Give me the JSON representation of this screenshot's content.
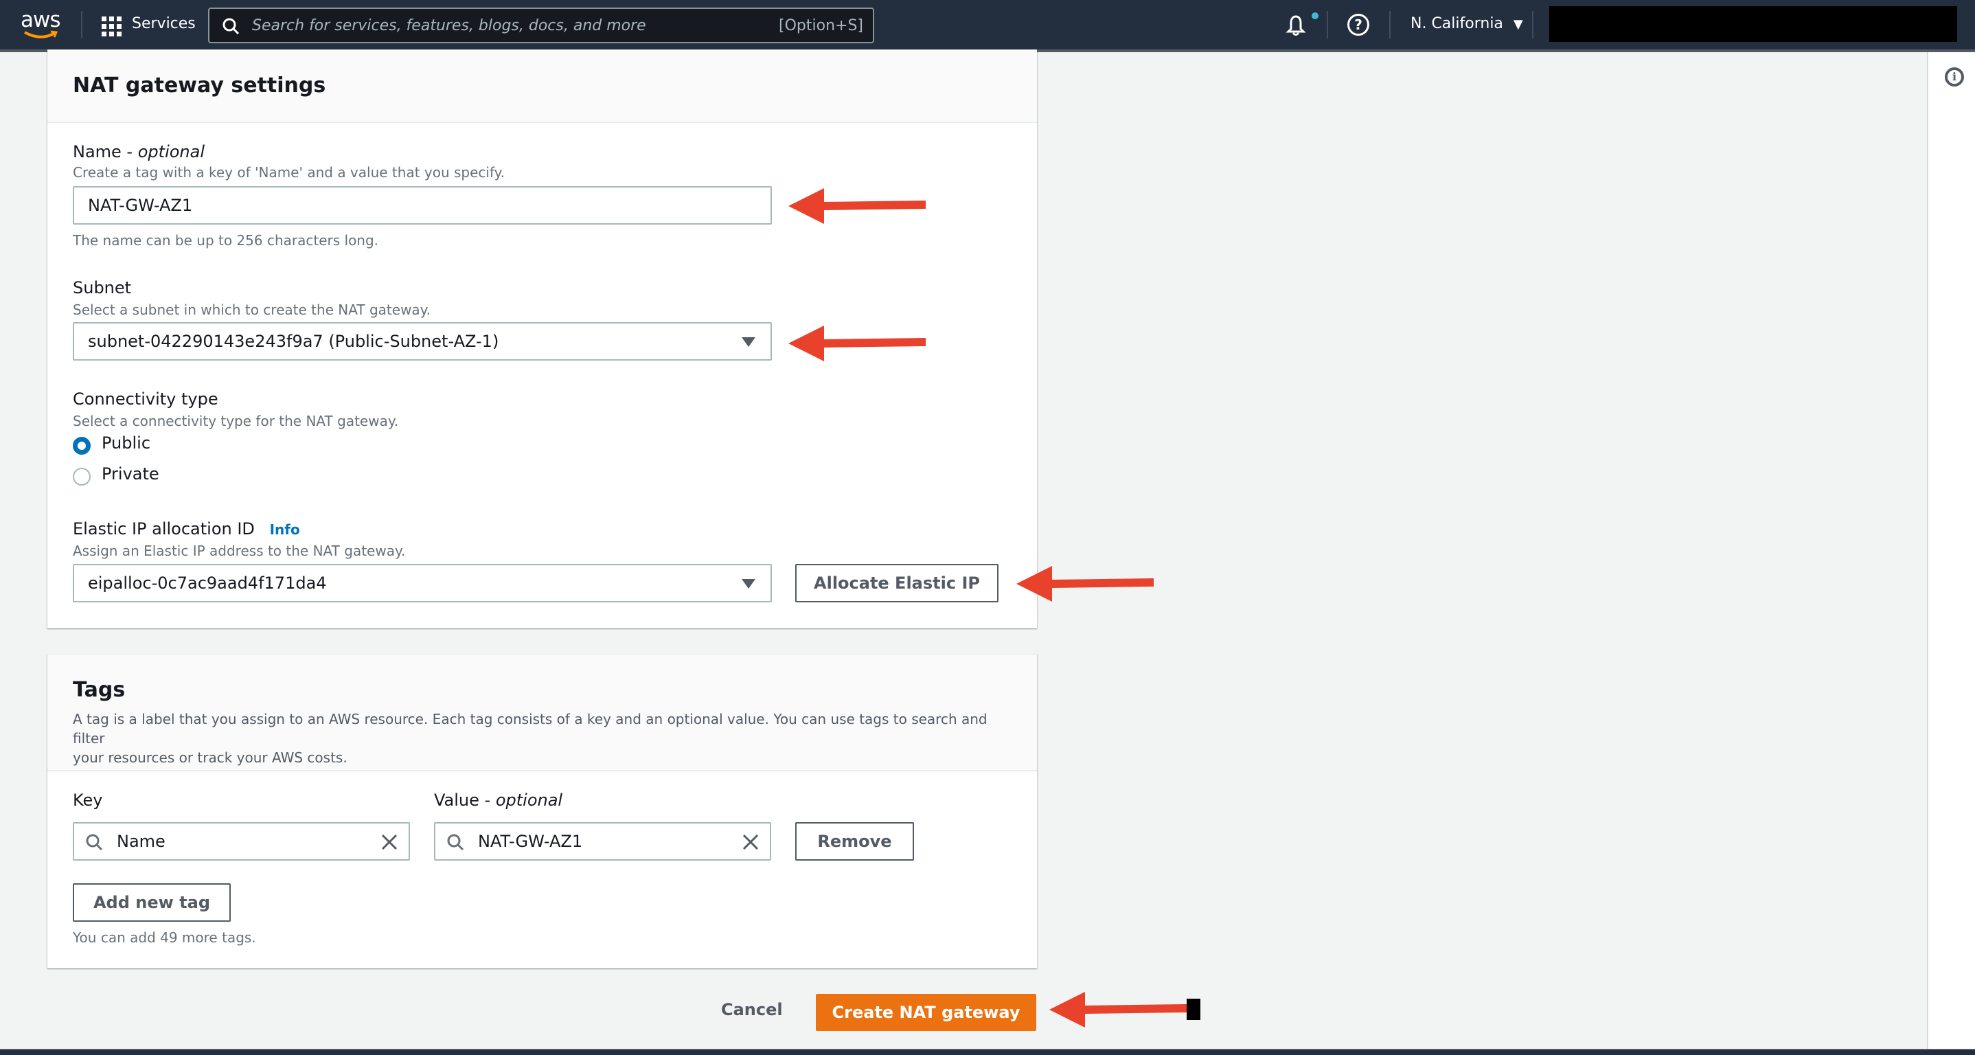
{
  "topnav": {
    "logo": "aws",
    "services_label": "Services",
    "search_placeholder": "Search for services, features, blogs, docs, and more",
    "search_shortcut": "[Option+S]",
    "region": "N. California",
    "icons": [
      "grid-icon",
      "search-icon",
      "bell-icon",
      "help-icon",
      "caret-down-icon"
    ]
  },
  "help_panel": {
    "icon": "info-icon"
  },
  "nat_settings": {
    "title": "NAT gateway settings",
    "name": {
      "label": "Name - ",
      "label_optional": "optional",
      "description": "Create a tag with a key of 'Name' and a value that you specify.",
      "value": "NAT-GW-AZ1",
      "constraint": "The name can be up to 256 characters long."
    },
    "subnet": {
      "label": "Subnet",
      "description": "Select a subnet in which to create the NAT gateway.",
      "selected": "subnet-042290143e243f9a7 (Public-Subnet-AZ-1)"
    },
    "connectivity": {
      "label": "Connectivity type",
      "description": "Select a connectivity type for the NAT gateway.",
      "options": [
        {
          "label": "Public",
          "selected": true
        },
        {
          "label": "Private",
          "selected": false
        }
      ]
    },
    "elastic_ip": {
      "label": "Elastic IP allocation ID",
      "info_link": "Info",
      "description": "Assign an Elastic IP address to the NAT gateway.",
      "selected": "eipalloc-0c7ac9aad4f171da4",
      "allocate_button": "Allocate Elastic IP"
    }
  },
  "tags": {
    "title": "Tags",
    "description_line1": "A tag is a label that you assign to an AWS resource. Each tag consists of a key and an optional value. You can use tags to search and filter",
    "description_line2": "your resources or track your AWS costs.",
    "key_label": "Key",
    "value_label": "Value - ",
    "value_label_optional": "optional",
    "rows": [
      {
        "key": "Name",
        "value": "NAT-GW-AZ1",
        "remove_label": "Remove"
      }
    ],
    "add_button": "Add new tag",
    "remaining": "You can add 49 more tags."
  },
  "footer": {
    "cancel": "Cancel",
    "create": "Create NAT gateway"
  },
  "colors": {
    "nav_bg": "#232f3e",
    "primary_button": "#ec7211",
    "link": "#0073bb",
    "annotation_arrow": "#e8412c"
  }
}
